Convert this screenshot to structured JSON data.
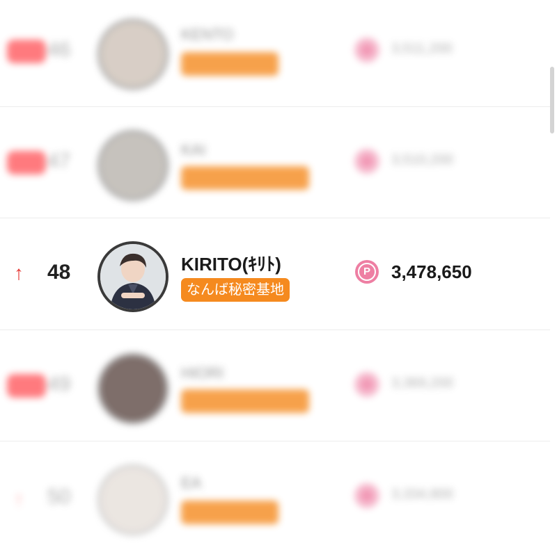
{
  "ranking": {
    "currency_icon": "point-coin-icon",
    "colors": {
      "shop_badge": "#f58a1f",
      "point_coin": "#ee7fa3",
      "rank_up": "#e53935",
      "new_badge": "#ff5a5f"
    },
    "rows": [
      {
        "rank": "46",
        "name": "KENTO",
        "shop": "",
        "points": "3,511,200",
        "blurred": true,
        "badge": "new-badge"
      },
      {
        "rank": "47",
        "name": "KAI",
        "shop": "",
        "points": "3,510,200",
        "blurred": true,
        "badge": "new-badge"
      },
      {
        "rank": "48",
        "name": "KIRITO(ｷﾘﾄ)",
        "shop": "なんば秘密基地",
        "points": "3,478,650",
        "blurred": false,
        "badge": "rank-up-arrow"
      },
      {
        "rank": "49",
        "name": "HIORI",
        "shop": "",
        "points": "3,369,200",
        "blurred": true,
        "badge": "new-badge"
      },
      {
        "rank": "50",
        "name": "EA",
        "shop": "",
        "points": "3,334,800",
        "blurred": true,
        "badge": "rank-up-arrow"
      }
    ]
  }
}
